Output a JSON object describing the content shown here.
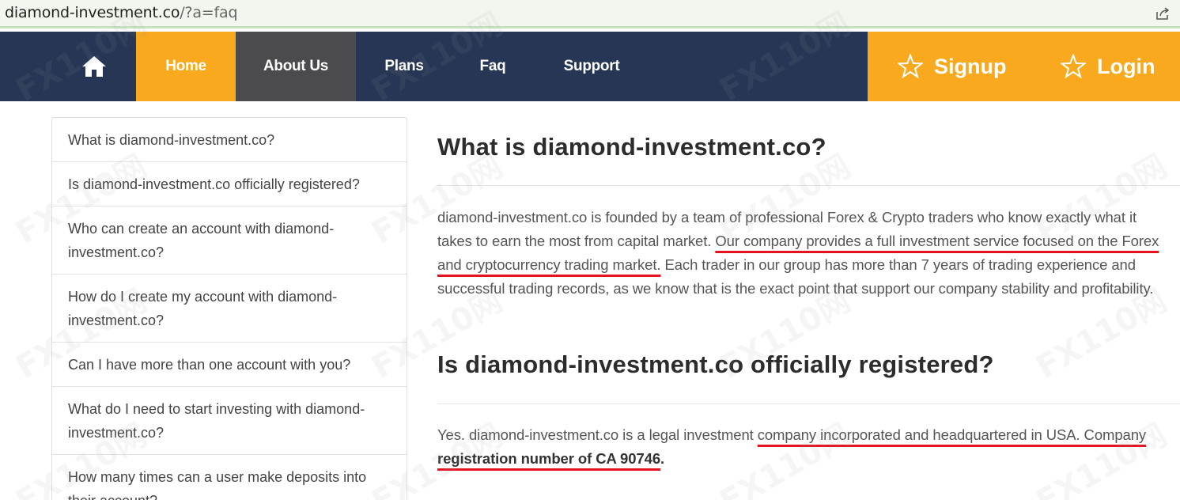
{
  "browser": {
    "url_host": "diamond-investment.co",
    "url_path": "/?a=faq"
  },
  "nav": {
    "home_icon": "home-icon",
    "items": [
      {
        "label": "Home",
        "active": true
      },
      {
        "label": "About Us"
      },
      {
        "label": "Plans"
      },
      {
        "label": "Faq"
      },
      {
        "label": "Support"
      }
    ],
    "signup": "Signup",
    "login": "Login",
    "colors": {
      "bar": "#283655",
      "accent": "#f9a91e",
      "about_bg": "#4b4a4c"
    }
  },
  "sidebar": {
    "questions": [
      "What is diamond-investment.co?",
      "Is diamond-investment.co officially registered?",
      "Who can create an account with diamond-investment.co?",
      "How do I create my account with diamond-investment.co?",
      "Can I have more than one account with you?",
      "What do I need to start investing with diamond-investment.co?",
      "How many times can a user make deposits into their account?"
    ]
  },
  "content": {
    "section1": {
      "title": "What is diamond-investment.co?",
      "text_a": "diamond-investment.co is founded by a team of professional Forex & Crypto traders who know exactly what it takes to earn the most from capital market. ",
      "text_underlined": "Our company provides a full investment service focused on the Forex and cryptocurrency trading market.",
      "text_b": " Each trader in our group has more than 7 years of trading experience and successful trading records, as we know that is the exact point that support our company stability and profitability."
    },
    "section2": {
      "title": "Is diamond-investment.co officially registered?",
      "text_a": "Yes. diamond-investment.co is a legal investment ",
      "text_underlined": "company incorporated and headquartered in USA. Company ",
      "text_bold_underlined": "registration number of CA 90746",
      "text_end": "."
    }
  },
  "watermark": "FX110网"
}
